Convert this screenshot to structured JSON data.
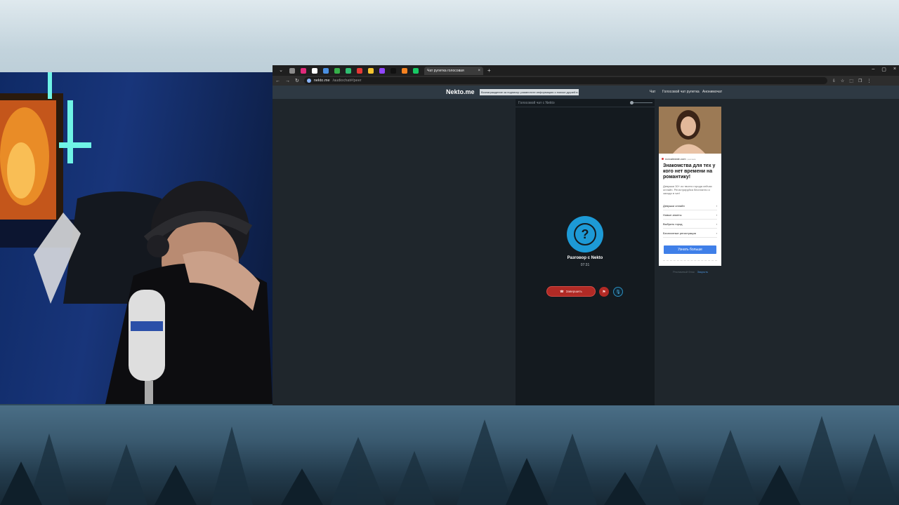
{
  "browser": {
    "tab_title": "Чат рулетка голосовая",
    "tab_close": "×",
    "new_tab": "+",
    "window_controls": [
      "–",
      "▢",
      "×"
    ],
    "nav": [
      "←",
      "→",
      "↻"
    ],
    "url_host": "nekto.me",
    "url_path": "/audiochat#/peer",
    "ext_icons": [
      "⇩",
      "☆",
      "⬚",
      "❐",
      "⋮"
    ]
  },
  "site": {
    "logo": "Nekto.me",
    "notice": "Вознаграждение за подписку: разместите информацию о поиске друзей в нашем канале",
    "menu": [
      "Чат",
      "Голосовой чат рулетка",
      "Анонимочат"
    ]
  },
  "chat": {
    "header": "Голосовой чат с Nekto",
    "avatar_glyph": "?",
    "title": "Разговор с Nekto",
    "timer": "07:31",
    "end_icon": "☎",
    "end_label": "Завершить",
    "report_icon": "⚑",
    "mic_icon": "🎙"
  },
  "ad": {
    "domain": "norcaledate.com",
    "domain_tag": "реклама",
    "title": "Знакомства для тех у кого нет времени на романтику!",
    "text": "Девушки 30+ из твоего города сейчас онлайн. Регистрируйся бесплатно и заходи в чат!",
    "rows": [
      "Девушки онлайн",
      "Новые анкеты",
      "Выбрать город",
      "Бесплатные регистрация"
    ],
    "button": "Узнать больше",
    "footer_prefix": "Рекламный блок",
    "footer_link": "Закрыть"
  },
  "colors": {
    "accent": "#1d9ad6",
    "end_call": "#b12a25",
    "ad_button": "#3f7fe8"
  }
}
